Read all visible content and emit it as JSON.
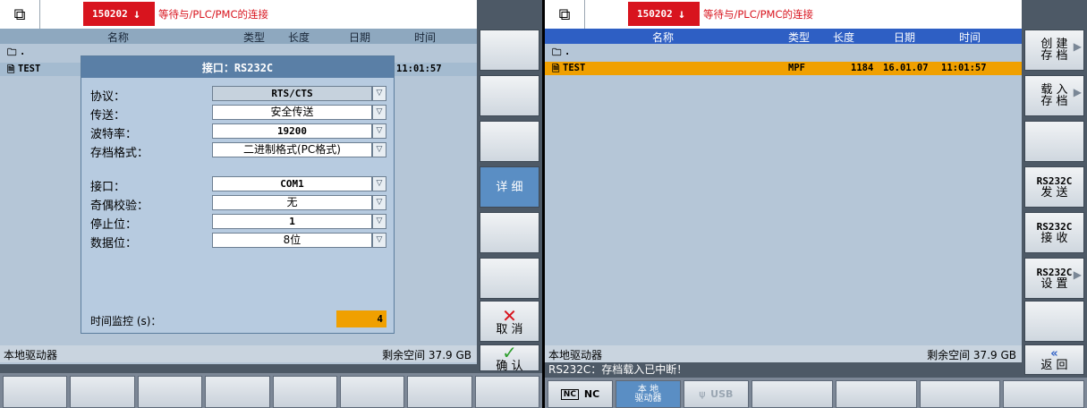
{
  "left": {
    "window_icon": "window-switch-icon",
    "alarm_code": "150202",
    "alarm_message": "等待与/PLC/PMC的连接",
    "columns": [
      "名称",
      "类型",
      "长度",
      "日期",
      "时间"
    ],
    "root_entry": ".",
    "file_name": "TEST",
    "file_time": "11:01:57",
    "drive_label": "本地驱动器",
    "free_space": "剩余空间 37.9 GB",
    "dialog": {
      "title": "接口：RS232C",
      "fields": [
        {
          "label": "协议：",
          "value": "RTS/CTS"
        },
        {
          "label": "传送：",
          "value": "安全传送"
        },
        {
          "label": "波特率：",
          "value": "19200"
        },
        {
          "label": "存档格式：",
          "value": "二进制格式(PC格式)"
        },
        {
          "label": "接口：",
          "value": "COM1"
        },
        {
          "label": "奇偶校验：",
          "value": "无"
        },
        {
          "label": "停止位：",
          "value": "1"
        },
        {
          "label": "数据位：",
          "value": "8位"
        }
      ],
      "timer_label": "时间监控 (s)：",
      "timer_value": "4"
    },
    "softkeys": {
      "detail": "详 细",
      "cancel": "取 消",
      "confirm": "确 认"
    }
  },
  "right": {
    "alarm_code": "150202",
    "alarm_message": "等待与/PLC/PMC的连接",
    "columns": [
      "名称",
      "类型",
      "长度",
      "日期",
      "时间"
    ],
    "root_entry": ".",
    "file": {
      "name": "TEST",
      "type": "MPF",
      "length": "1184",
      "date": "16.01.07",
      "time": "11:01:57"
    },
    "drive_label": "本地驱动器",
    "free_space": "剩余空间 37.9 GB",
    "status_message": "RS232C：存档载入已中断！",
    "softkeys": {
      "create_1": "创 建",
      "create_2": "存 档",
      "load_1": "载 入",
      "load_2": "存 档",
      "send_1": "RS232C",
      "send_2": "发 送",
      "recv_1": "RS232C",
      "recv_2": "接 收",
      "set_1": "RS232C",
      "set_2": "设 置",
      "back": "返 回"
    },
    "nav": {
      "nc": "NC",
      "local_1": "本 地",
      "local_2": "驱动器",
      "usb": "USB"
    }
  },
  "colors": {
    "alarm": "#d8141e",
    "selection": "#f0a000",
    "header": "#8ea8bf",
    "active_key": "#5a8ec4"
  }
}
